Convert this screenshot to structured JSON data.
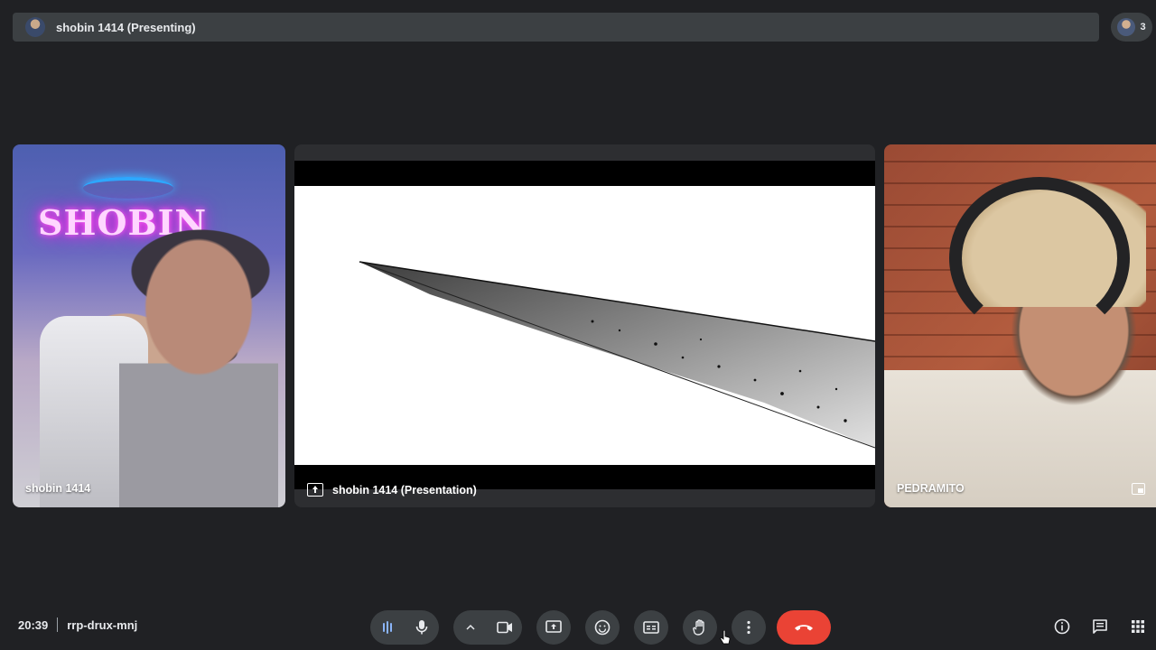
{
  "header": {
    "presenter_title": "shobin 1414 (Presenting)",
    "participant_count": "3"
  },
  "tiles": {
    "left": {
      "name": "shobin 1414",
      "neon_sign": "SHOBIN"
    },
    "center": {
      "name": "shobin 1414 (Presentation)"
    },
    "right": {
      "name": "PEDRAMITO"
    }
  },
  "footer": {
    "time": "20:39",
    "meeting_code": "rrp-drux-mnj"
  },
  "controls": [
    {
      "name": "audio-level-icon"
    },
    {
      "name": "microphone-icon"
    },
    {
      "name": "chevron-up-icon"
    },
    {
      "name": "camera-icon"
    },
    {
      "name": "present-screen-icon"
    },
    {
      "name": "emoji-icon"
    },
    {
      "name": "captions-icon"
    },
    {
      "name": "raise-hand-icon"
    },
    {
      "name": "more-options-icon"
    },
    {
      "name": "end-call-icon"
    }
  ],
  "colors": {
    "background": "#202124",
    "surface": "#3c4043",
    "end_call": "#ea4335",
    "accent": "#8ab4f8"
  }
}
